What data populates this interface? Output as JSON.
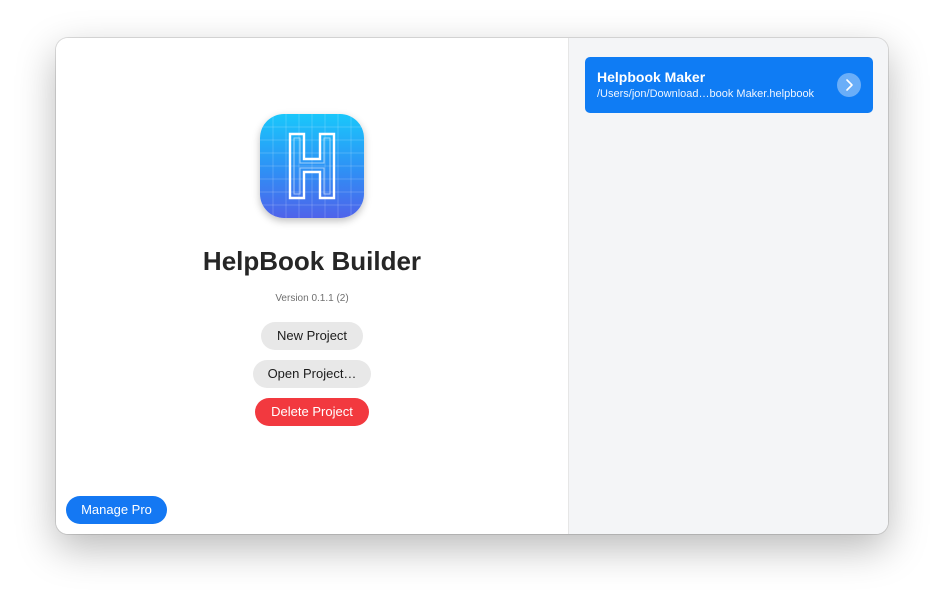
{
  "app": {
    "name": "HelpBook Builder",
    "version": "Version 0.1.1 (2)",
    "icon": "helpbook-h-icon"
  },
  "buttons": {
    "new_project": "New Project",
    "open_project": "Open Project…",
    "delete_project": "Delete Project",
    "manage_pro": "Manage Pro"
  },
  "recent_projects": [
    {
      "title": "Helpbook Maker",
      "path": "/Users/jon/Download…book Maker.helpbook",
      "action_icon": "chevron-right-icon"
    }
  ],
  "colors": {
    "accent": "#1478f3",
    "danger": "#f2393f",
    "sidebar_bg": "#f4f5f7"
  }
}
